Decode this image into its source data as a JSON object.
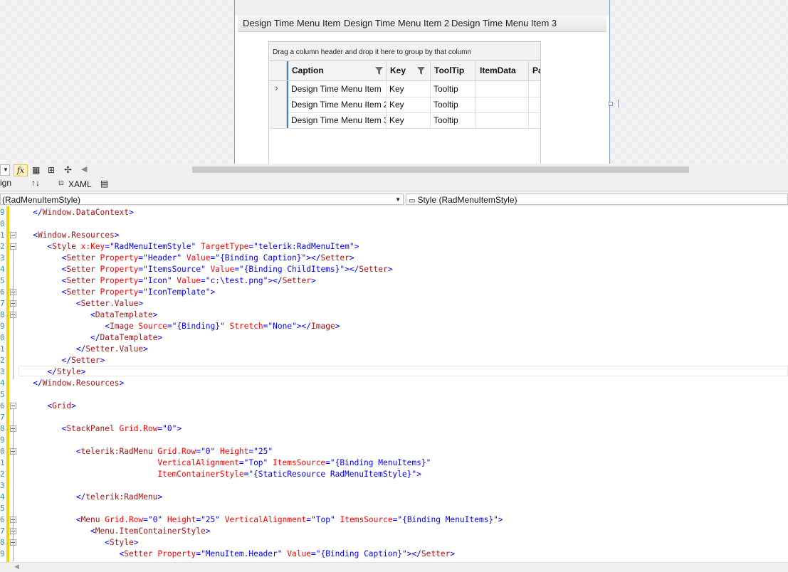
{
  "designer": {
    "menu_items": [
      "Design Time Menu Item",
      "Design Time Menu Item 2",
      "Design Time Menu Item 3"
    ],
    "grid": {
      "group_panel_text": "Drag a column header and drop it here to group by that column",
      "columns": [
        "Caption",
        "Key",
        "ToolTip",
        "ItemData",
        "Pa"
      ],
      "rows": [
        [
          "Design Time Menu Item",
          "Key",
          "Tooltip",
          "",
          ""
        ],
        [
          "Design Time Menu Item 2",
          "Key",
          "Tooltip",
          "",
          ""
        ],
        [
          "Design Time Menu Item 3",
          "Key",
          "Tooltip",
          "",
          ""
        ]
      ]
    }
  },
  "toolbar": {
    "fx_label": "fx",
    "design_tab_partial": "ign",
    "swap_icon_label": "↑↓",
    "xaml_tab": "XAML",
    "left_combo": "(RadMenuItemStyle)",
    "right_combo": "Style (RadMenuItemStyle)"
  },
  "editor": {
    "line_numbers": [
      "9",
      "0",
      "1",
      "2",
      "3",
      "4",
      "5",
      "6",
      "7",
      "8",
      "9",
      "0",
      "1",
      "2",
      "3",
      "4",
      "5",
      "6",
      "7",
      "8",
      "9",
      "0",
      "1",
      "2",
      "3",
      "4",
      "5",
      "6",
      "7",
      "8",
      "9"
    ],
    "lines": [
      [
        [
          "tag",
          "   </Window.DataContext>"
        ]
      ],
      [],
      [
        [
          "tag",
          "   <Window.Resources>"
        ]
      ],
      [
        [
          "tag",
          "      <Style "
        ],
        [
          "attr",
          "x:Key"
        ],
        [
          "tag",
          "=\""
        ],
        [
          "val",
          "RadMenuItemStyle"
        ],
        [
          "tag",
          "\" "
        ],
        [
          "attr",
          "TargetType"
        ],
        [
          "tag",
          "=\""
        ],
        [
          "val",
          "telerik:RadMenuItem"
        ],
        [
          "tag",
          "\">"
        ]
      ],
      [
        [
          "tag",
          "         <Setter "
        ],
        [
          "attr",
          "Property"
        ],
        [
          "tag",
          "=\""
        ],
        [
          "val",
          "Header"
        ],
        [
          "tag",
          "\" "
        ],
        [
          "attr",
          "Value"
        ],
        [
          "tag",
          "=\""
        ],
        [
          "val",
          "{Binding Caption}"
        ],
        [
          "tag",
          "\"></Setter>"
        ]
      ],
      [
        [
          "tag",
          "         <Setter "
        ],
        [
          "attr",
          "Property"
        ],
        [
          "tag",
          "=\""
        ],
        [
          "val",
          "ItemsSource"
        ],
        [
          "tag",
          "\" "
        ],
        [
          "attr",
          "Value"
        ],
        [
          "tag",
          "=\""
        ],
        [
          "val",
          "{Binding ChildItems}"
        ],
        [
          "tag",
          "\"></Setter>"
        ]
      ],
      [
        [
          "tag",
          "         <Setter "
        ],
        [
          "attr",
          "Property"
        ],
        [
          "tag",
          "=\""
        ],
        [
          "val",
          "Icon"
        ],
        [
          "tag",
          "\" "
        ],
        [
          "attr",
          "Value"
        ],
        [
          "tag",
          "=\""
        ],
        [
          "val",
          "c:\\test.png"
        ],
        [
          "tag",
          "\"></Setter>"
        ]
      ],
      [
        [
          "tag",
          "         <Setter "
        ],
        [
          "attr",
          "Property"
        ],
        [
          "tag",
          "=\""
        ],
        [
          "val",
          "IconTemplate"
        ],
        [
          "tag",
          "\">"
        ]
      ],
      [
        [
          "tag",
          "            <Setter.Value>"
        ]
      ],
      [
        [
          "tag",
          "               <DataTemplate>"
        ]
      ],
      [
        [
          "tag",
          "                  <Image "
        ],
        [
          "attr",
          "Source"
        ],
        [
          "tag",
          "=\""
        ],
        [
          "val",
          "{Binding}"
        ],
        [
          "tag",
          "\" "
        ],
        [
          "attr",
          "Stretch"
        ],
        [
          "tag",
          "=\""
        ],
        [
          "val",
          "None"
        ],
        [
          "tag",
          "\"></Image>"
        ]
      ],
      [
        [
          "tag",
          "               </DataTemplate>"
        ]
      ],
      [
        [
          "tag",
          "            </Setter.Value>"
        ]
      ],
      [
        [
          "tag",
          "         </Setter>"
        ]
      ],
      [
        [
          "tag",
          "      </Style>"
        ]
      ],
      [
        [
          "tag",
          "   </Window.Resources>"
        ]
      ],
      [],
      [
        [
          "tag",
          "      <Grid>"
        ]
      ],
      [],
      [
        [
          "tag",
          "         <StackPanel "
        ],
        [
          "attr",
          "Grid.Row"
        ],
        [
          "tag",
          "=\""
        ],
        [
          "val",
          "0"
        ],
        [
          "tag",
          "\">"
        ]
      ],
      [],
      [
        [
          "tag",
          "            <telerik:RadMenu "
        ],
        [
          "attr",
          "Grid.Row"
        ],
        [
          "tag",
          "=\""
        ],
        [
          "val",
          "0"
        ],
        [
          "tag",
          "\" "
        ],
        [
          "attr",
          "Height"
        ],
        [
          "tag",
          "=\""
        ],
        [
          "val",
          "25"
        ],
        [
          "tag",
          "\""
        ]
      ],
      [
        [
          "tag",
          "                             "
        ],
        [
          "attr",
          "VerticalAlignment"
        ],
        [
          "tag",
          "=\""
        ],
        [
          "val",
          "Top"
        ],
        [
          "tag",
          "\" "
        ],
        [
          "attr",
          "ItemsSource"
        ],
        [
          "tag",
          "=\""
        ],
        [
          "val",
          "{Binding MenuItems}"
        ],
        [
          "tag",
          "\""
        ]
      ],
      [
        [
          "tag",
          "                             "
        ],
        [
          "attr",
          "ItemContainerStyle"
        ],
        [
          "tag",
          "=\""
        ],
        [
          "val",
          "{StaticResource RadMenuItemStyle}"
        ],
        [
          "tag",
          "\">"
        ]
      ],
      [],
      [
        [
          "tag",
          "            </telerik:RadMenu>"
        ]
      ],
      [],
      [
        [
          "tag",
          "            <Menu "
        ],
        [
          "attr",
          "Grid.Row"
        ],
        [
          "tag",
          "=\""
        ],
        [
          "val",
          "0"
        ],
        [
          "tag",
          "\" "
        ],
        [
          "attr",
          "Height"
        ],
        [
          "tag",
          "=\""
        ],
        [
          "val",
          "25"
        ],
        [
          "tag",
          "\" "
        ],
        [
          "attr",
          "VerticalAlignment"
        ],
        [
          "tag",
          "=\""
        ],
        [
          "val",
          "Top"
        ],
        [
          "tag",
          "\" "
        ],
        [
          "attr",
          "ItemsSource"
        ],
        [
          "tag",
          "=\""
        ],
        [
          "val",
          "{Binding MenuItems}"
        ],
        [
          "tag",
          "\">"
        ]
      ],
      [
        [
          "tag",
          "               <Menu.ItemContainerStyle>"
        ]
      ],
      [
        [
          "tag",
          "                  <Style>"
        ]
      ],
      [
        [
          "tag",
          "                     <Setter "
        ],
        [
          "attr",
          "Property"
        ],
        [
          "tag",
          "=\""
        ],
        [
          "val",
          "MenuItem.Header"
        ],
        [
          "tag",
          "\" "
        ],
        [
          "attr",
          "Value"
        ],
        [
          "tag",
          "=\""
        ],
        [
          "val",
          "{Binding Caption}"
        ],
        [
          "tag",
          "\"></Setter>"
        ]
      ]
    ],
    "colors": {
      "tag": "#a31515",
      "attr": "#ff0000",
      "val": "#0000ff",
      "bracket": "#0000ff",
      "linenum": "#2b91af",
      "change_bar": "#f5d300"
    }
  }
}
